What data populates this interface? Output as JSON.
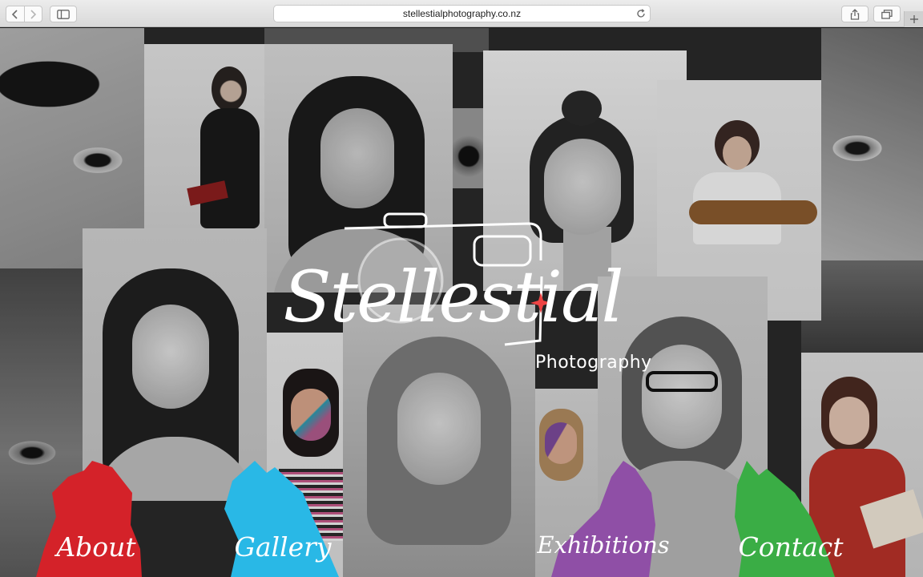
{
  "browser": {
    "url": "stellestialphotography.co.nz"
  },
  "logo": {
    "script": "Stellestial",
    "subtitle": "Photography"
  },
  "nav": [
    {
      "label": "About",
      "color": "#d42229"
    },
    {
      "label": "Gallery",
      "color": "#29b8e6"
    },
    {
      "label": "Exhibitions",
      "color": "#8f4fa6"
    },
    {
      "label": "Contact",
      "color": "#3aad45"
    }
  ]
}
